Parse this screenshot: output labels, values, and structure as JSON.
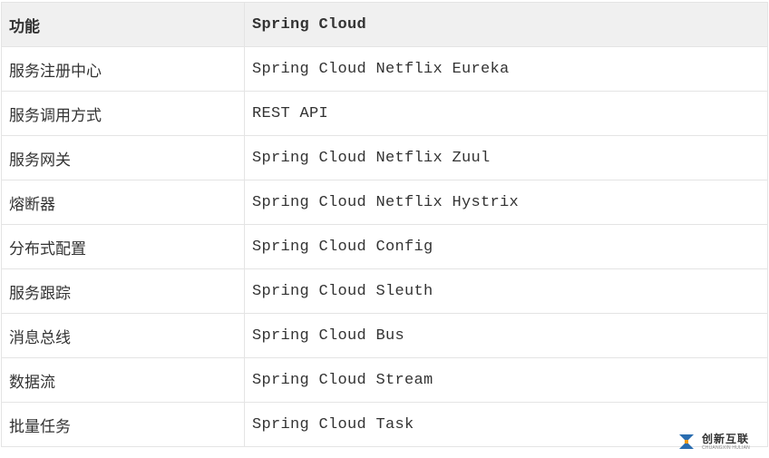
{
  "table": {
    "headers": [
      "功能",
      "Spring Cloud"
    ],
    "rows": [
      [
        "服务注册中心",
        "Spring Cloud Netflix Eureka"
      ],
      [
        "服务调用方式",
        "REST API"
      ],
      [
        "服务网关",
        "Spring Cloud Netflix Zuul"
      ],
      [
        "熔断器",
        "Spring Cloud Netflix Hystrix"
      ],
      [
        "分布式配置",
        "Spring Cloud Config"
      ],
      [
        "服务跟踪",
        "Spring Cloud Sleuth"
      ],
      [
        "消息总线",
        "Spring Cloud Bus"
      ],
      [
        "数据流",
        "Spring Cloud Stream"
      ],
      [
        "批量任务",
        "Spring Cloud Task"
      ]
    ]
  },
  "watermark": {
    "cn": "创新互联",
    "en": "CHUANGXIN HULIAN"
  }
}
